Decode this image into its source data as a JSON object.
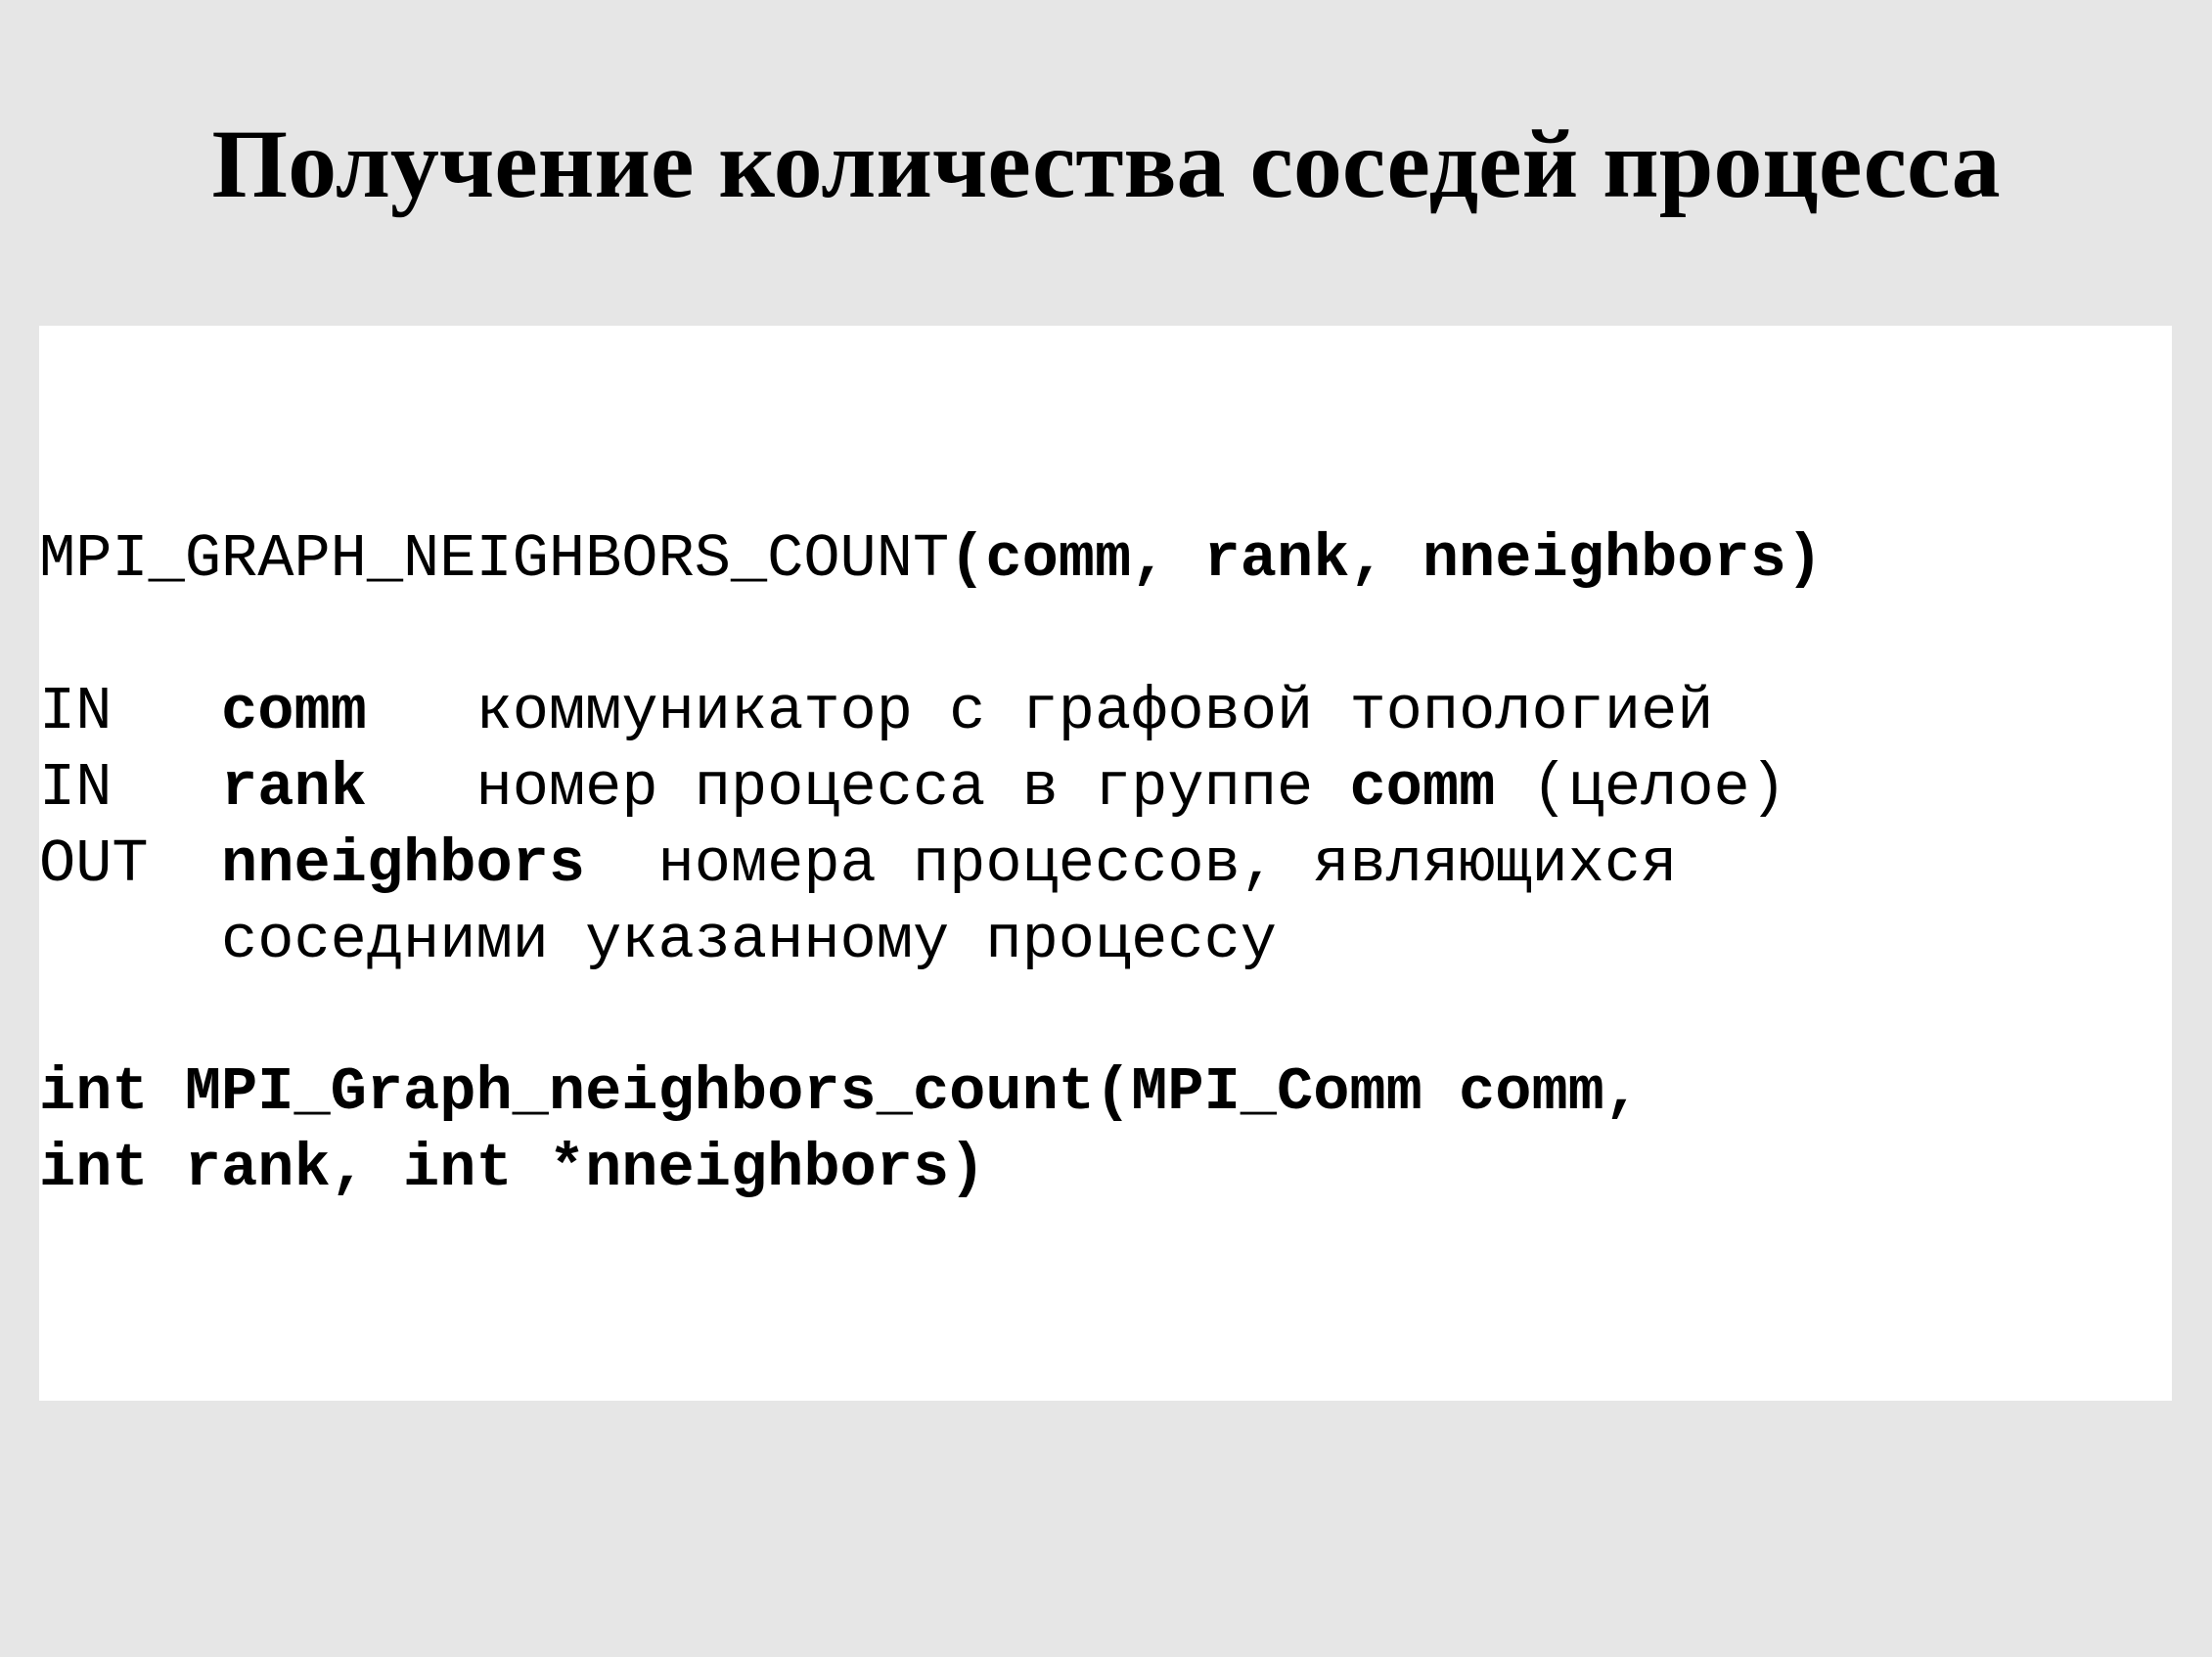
{
  "title": "Получение количества соседей процесса",
  "signature": {
    "name": "MPI_GRAPH_NEIGHBORS_COUNT",
    "args": "(comm, rank, nneighbors)"
  },
  "params": [
    {
      "direction": "IN",
      "name": "comm",
      "description": "коммуникатор с графовой топологией"
    },
    {
      "direction": "IN",
      "name": "rank",
      "description_before": "номер процесса в группе",
      "description_ref": "comm",
      "description_after": "(целое)"
    },
    {
      "direction": "OUT",
      "name": "nneighbors",
      "description": "номера процессов, являющихся",
      "description_cont": "соседними указанному процессу"
    }
  ],
  "c_binding": {
    "line1": "int MPI_Graph_neighbors_count(MPI_Comm comm,",
    "line2": "int rank, int *nneighbors)"
  }
}
